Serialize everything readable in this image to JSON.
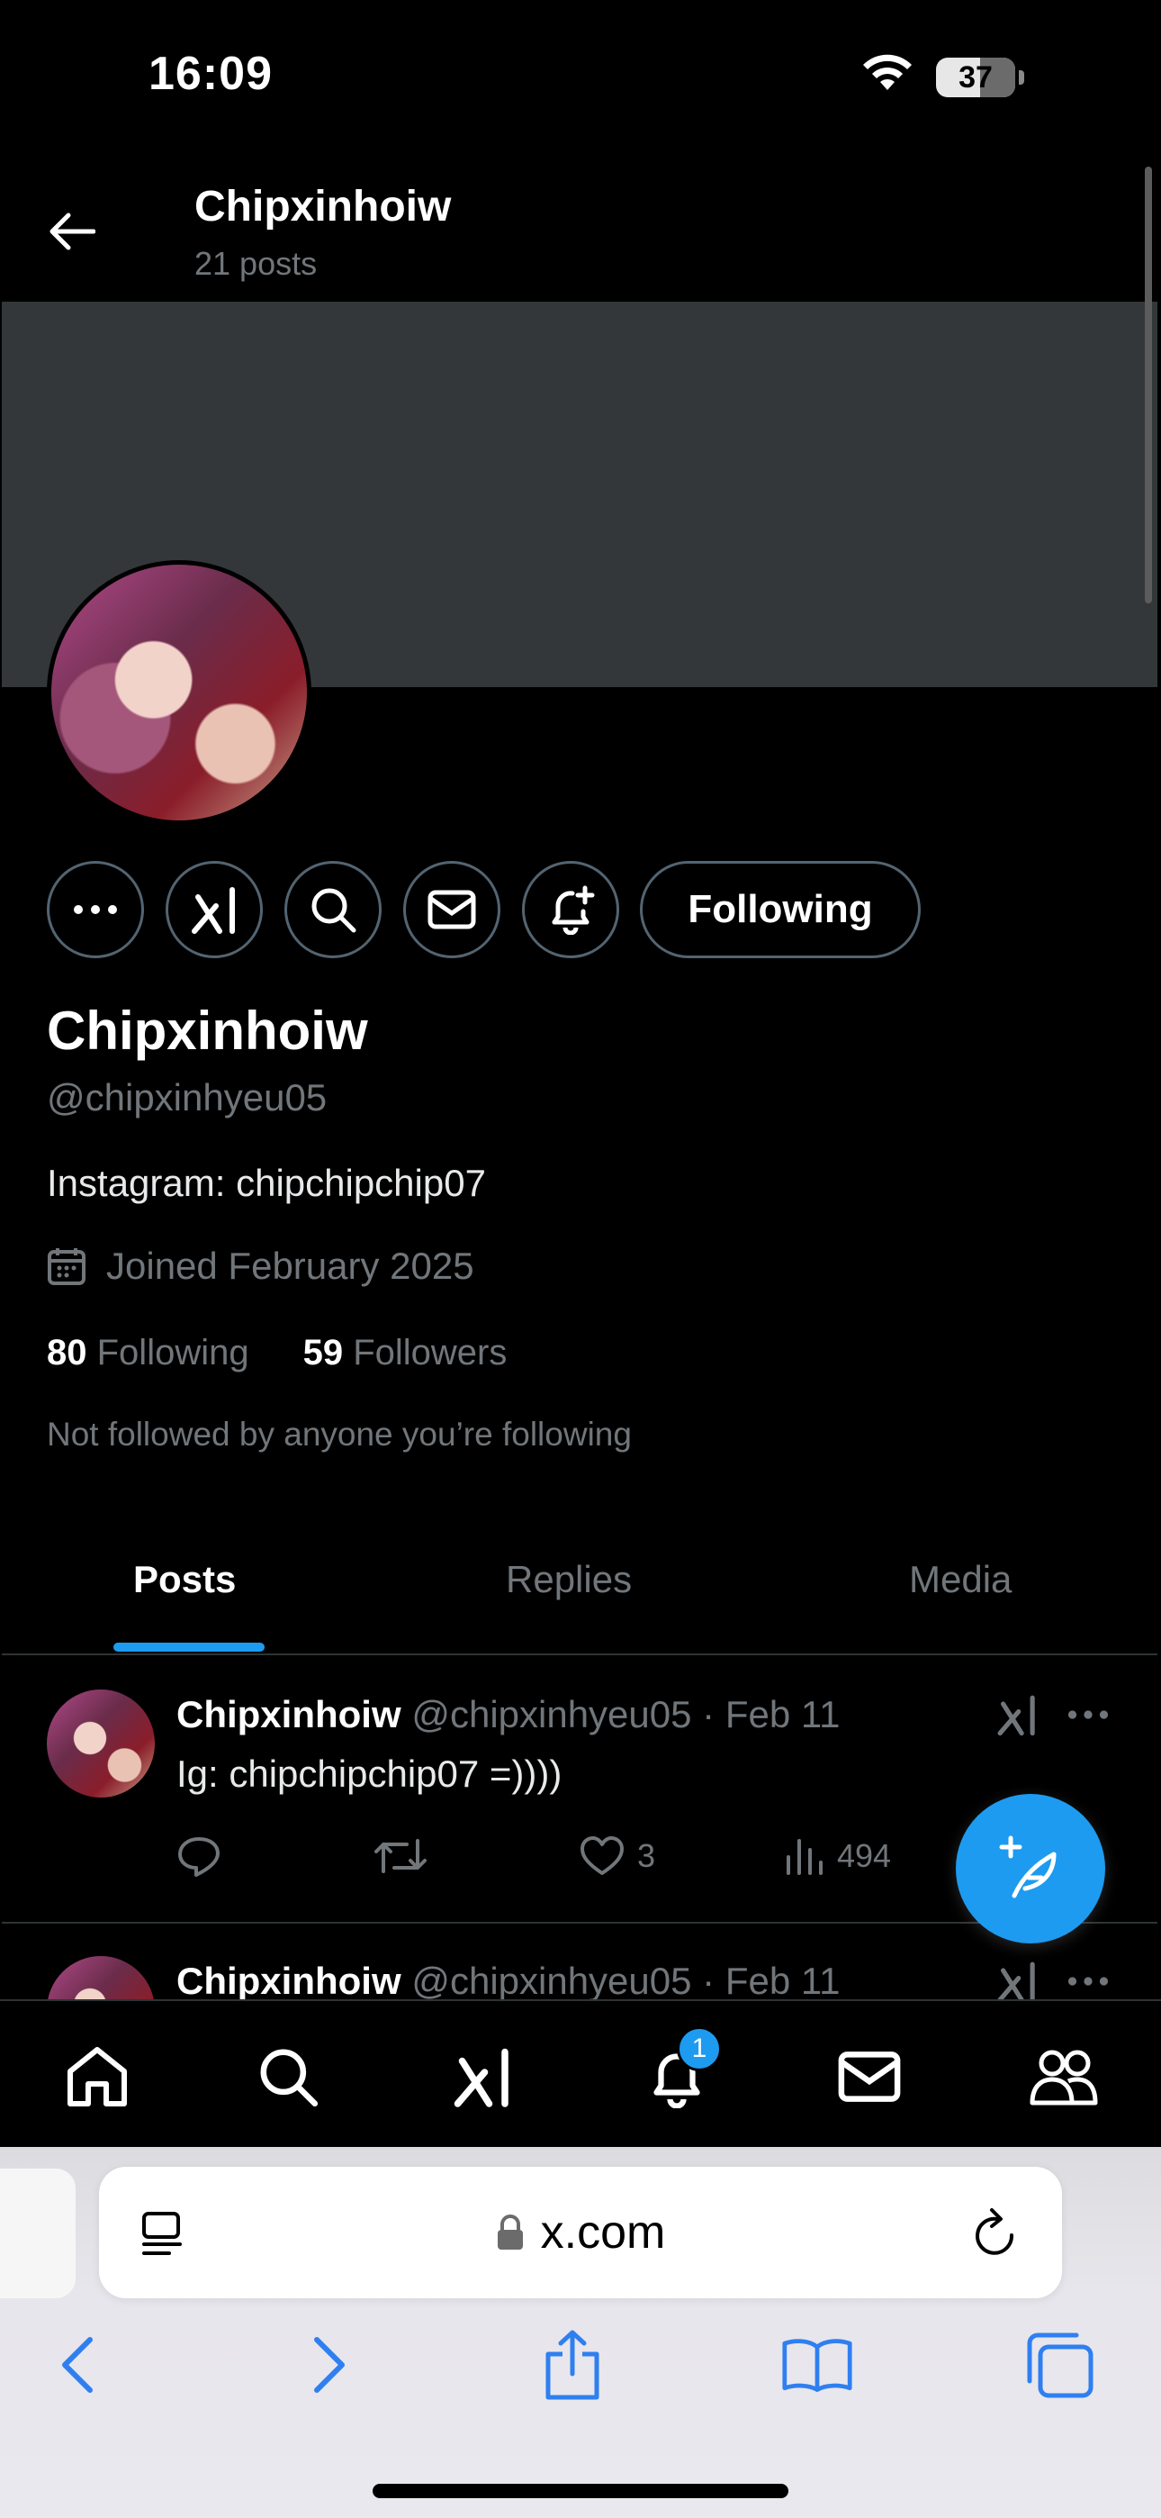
{
  "status_bar": {
    "time": "16:09",
    "battery": "37"
  },
  "header": {
    "title": "Chipxinhoiw",
    "subtitle": "21 posts"
  },
  "profile": {
    "name": "Chipxinhoiw",
    "handle": "@chipxinhyeu05",
    "bio": "Instagram: chipchipchip07",
    "joined": "Joined February 2025",
    "following_count": "80",
    "following_label": "Following",
    "followers_count": "59",
    "followers_label": "Followers",
    "not_followed": "Not followed by anyone you’re following",
    "follow_button": "Following"
  },
  "tabs": [
    {
      "label": "Posts"
    },
    {
      "label": "Replies"
    },
    {
      "label": "Media"
    }
  ],
  "posts": [
    {
      "name": "Chipxinhoiw",
      "meta": "@chipxinhyeu05 · Feb 11",
      "text": "Ig: chipchipchip07 =))))",
      "likes": "3",
      "views": "494"
    },
    {
      "name": "Chipxinhoiw",
      "meta": "@chipxinhyeu05 · Feb 11"
    }
  ],
  "bottom_nav": {
    "notif_badge": "1"
  },
  "browser": {
    "url": "x.com"
  },
  "colors": {
    "accent": "#1d9bf0",
    "banner": "#33373a",
    "muted": "#71767b"
  }
}
